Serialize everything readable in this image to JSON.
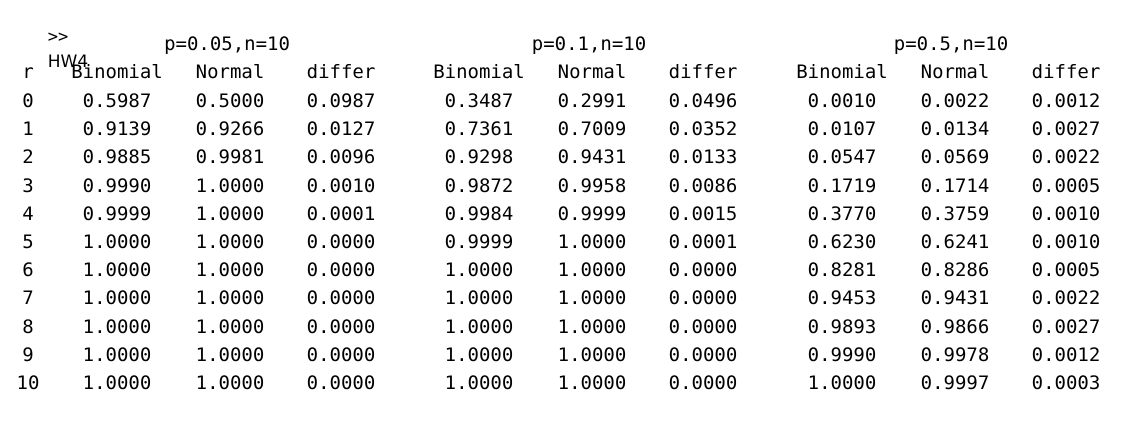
{
  "console": {
    "prompt": ">>",
    "command": "HW4"
  },
  "table": {
    "group_titles": [
      "p=0.05,n=10",
      "p=0.1,n=10",
      "p=0.5,n=10"
    ],
    "r_header": "r",
    "sub_headers": [
      "Binomial",
      "Normal",
      "differ"
    ],
    "rows": [
      {
        "r": "0",
        "values": [
          "0.5987",
          "0.5000",
          "0.0987",
          "0.3487",
          "0.2991",
          "0.0496",
          "0.0010",
          "0.0022",
          "0.0012"
        ]
      },
      {
        "r": "1",
        "values": [
          "0.9139",
          "0.9266",
          "0.0127",
          "0.7361",
          "0.7009",
          "0.0352",
          "0.0107",
          "0.0134",
          "0.0027"
        ]
      },
      {
        "r": "2",
        "values": [
          "0.9885",
          "0.9981",
          "0.0096",
          "0.9298",
          "0.9431",
          "0.0133",
          "0.0547",
          "0.0569",
          "0.0022"
        ]
      },
      {
        "r": "3",
        "values": [
          "0.9990",
          "1.0000",
          "0.0010",
          "0.9872",
          "0.9958",
          "0.0086",
          "0.1719",
          "0.1714",
          "0.0005"
        ]
      },
      {
        "r": "4",
        "values": [
          "0.9999",
          "1.0000",
          "0.0001",
          "0.9984",
          "0.9999",
          "0.0015",
          "0.3770",
          "0.3759",
          "0.0010"
        ]
      },
      {
        "r": "5",
        "values": [
          "1.0000",
          "1.0000",
          "0.0000",
          "0.9999",
          "1.0000",
          "0.0001",
          "0.6230",
          "0.6241",
          "0.0010"
        ]
      },
      {
        "r": "6",
        "values": [
          "1.0000",
          "1.0000",
          "0.0000",
          "1.0000",
          "1.0000",
          "0.0000",
          "0.8281",
          "0.8286",
          "0.0005"
        ]
      },
      {
        "r": "7",
        "values": [
          "1.0000",
          "1.0000",
          "0.0000",
          "1.0000",
          "1.0000",
          "0.0000",
          "0.9453",
          "0.9431",
          "0.0022"
        ]
      },
      {
        "r": "8",
        "values": [
          "1.0000",
          "1.0000",
          "0.0000",
          "1.0000",
          "1.0000",
          "0.0000",
          "0.9893",
          "0.9866",
          "0.0027"
        ]
      },
      {
        "r": "9",
        "values": [
          "1.0000",
          "1.0000",
          "0.0000",
          "1.0000",
          "1.0000",
          "0.0000",
          "0.9990",
          "0.9978",
          "0.0012"
        ]
      },
      {
        "r": "10",
        "values": [
          "1.0000",
          "1.0000",
          "0.0000",
          "1.0000",
          "1.0000",
          "0.0000",
          "1.0000",
          "0.9997",
          "0.0003"
        ]
      }
    ]
  }
}
